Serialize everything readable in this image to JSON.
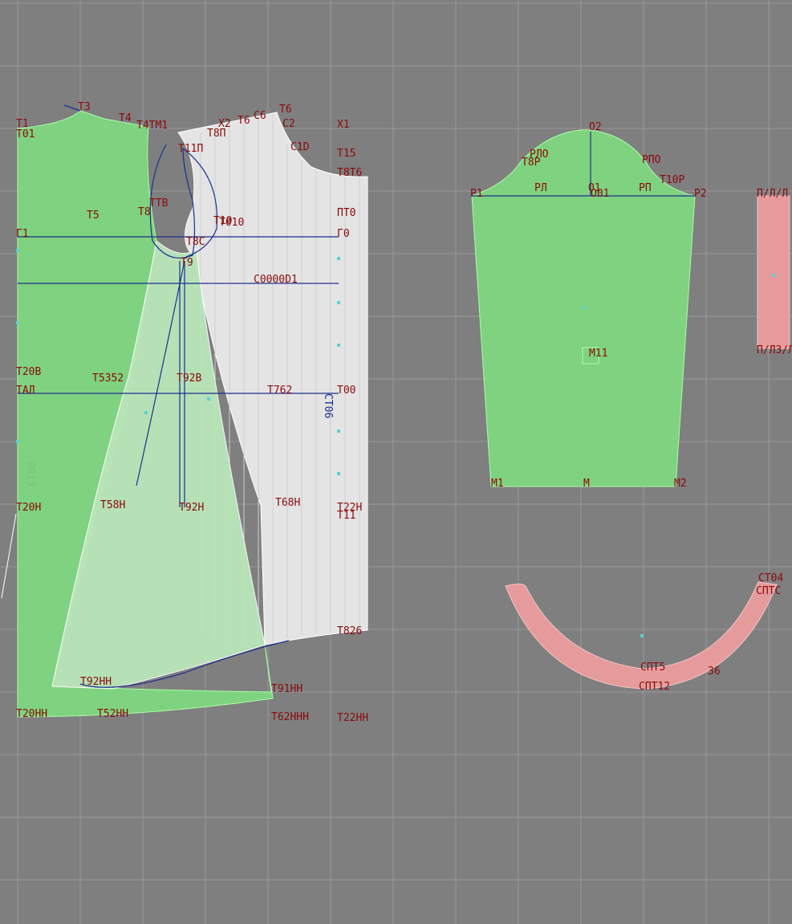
{
  "colors": {
    "background": "#7f7f7f",
    "grid": "#9c9c9c",
    "piece_green": "#7fd27f",
    "piece_white": "#e4e4e4",
    "piece_pink": "#e59b9b",
    "label": "#8a0a0a",
    "construction_line": "#1c2f8f",
    "point_marker": "#5fd0d0"
  },
  "labels": {
    "t1": "T1",
    "t01": "T01",
    "t3": "T3",
    "t4": "T4",
    "t41": "T4TM1",
    "t5": "T5",
    "t8": "T8",
    "ttb": "TTB",
    "t11p": "T11П",
    "t8p": "T8П",
    "t10": "T10",
    "t010": "T010",
    "t9": "T9",
    "t8c": "T8C",
    "g1": "Г1",
    "g0": "Г0",
    "t20b": "T20B",
    "tal": "TAЛ",
    "t352": "T5352",
    "t92b": "T92B",
    "t62": "T762",
    "t00": "T00",
    "cond": "C0000D1",
    "t20n": "T20H",
    "t58n": "T58H",
    "t92n": "T92H",
    "t68n": "T68H",
    "t22n": "T22H",
    "tt1": "T11",
    "t92hh": "T92HH",
    "t91hh": "T91HH",
    "t20hh": "T20HH",
    "t52hh": "T52HH",
    "t62hh": "T62HHH",
    "t22hh": "T22HH",
    "t826": "T826",
    "x1": "X1",
    "c2": "C2",
    "c10": "C1D",
    "t15": "T15",
    "t8t6": "T8T6",
    "pt0": "ПТ0",
    "t6": "T6",
    "c6": "C6",
    "x2": "X2",
    "t6s": "T6",
    "stub_v": "СТ06",
    "stub_g": "СТ06",
    "o2": "O2",
    "rlo": "PЛO",
    "t8r": "T8P",
    "rpo": "PПO",
    "t10r": "T10P",
    "r1": "P1",
    "rl": "PЛ",
    "o1": "O1",
    "o01": "O01",
    "rp": "PП",
    "r2": "P2",
    "m11": "M11",
    "m1": "M1",
    "m": "M",
    "m2": "M2",
    "pl_top": "П/Л/Л",
    "pl_bot": "П/Л3/Л",
    "ct04": "CT04",
    "cpts": "CПTC",
    "ct5": "CПT5",
    "ct12": "CПT12",
    "n36": "36"
  }
}
